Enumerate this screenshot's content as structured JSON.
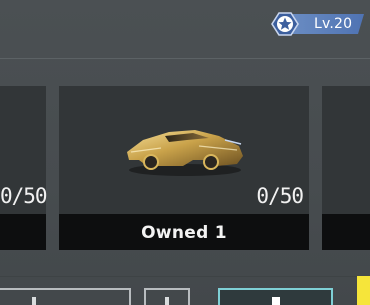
{
  "header": {
    "level_label": "Lv.20",
    "level_icon": "star-emblem-icon"
  },
  "cards": [
    {
      "name": "partial-left",
      "count": "0/50"
    },
    {
      "name": "gold-sports-car",
      "count": "0/50",
      "status": "Owned 1"
    }
  ],
  "colors": {
    "badge_blue": "#5a7fbd",
    "card_bg": "#323638",
    "footer_bg": "#0d0e0f",
    "car_gold": "#c9a24a",
    "highlight_cyan": "#7fd0d6",
    "accent_yellow": "#f6e53a"
  }
}
